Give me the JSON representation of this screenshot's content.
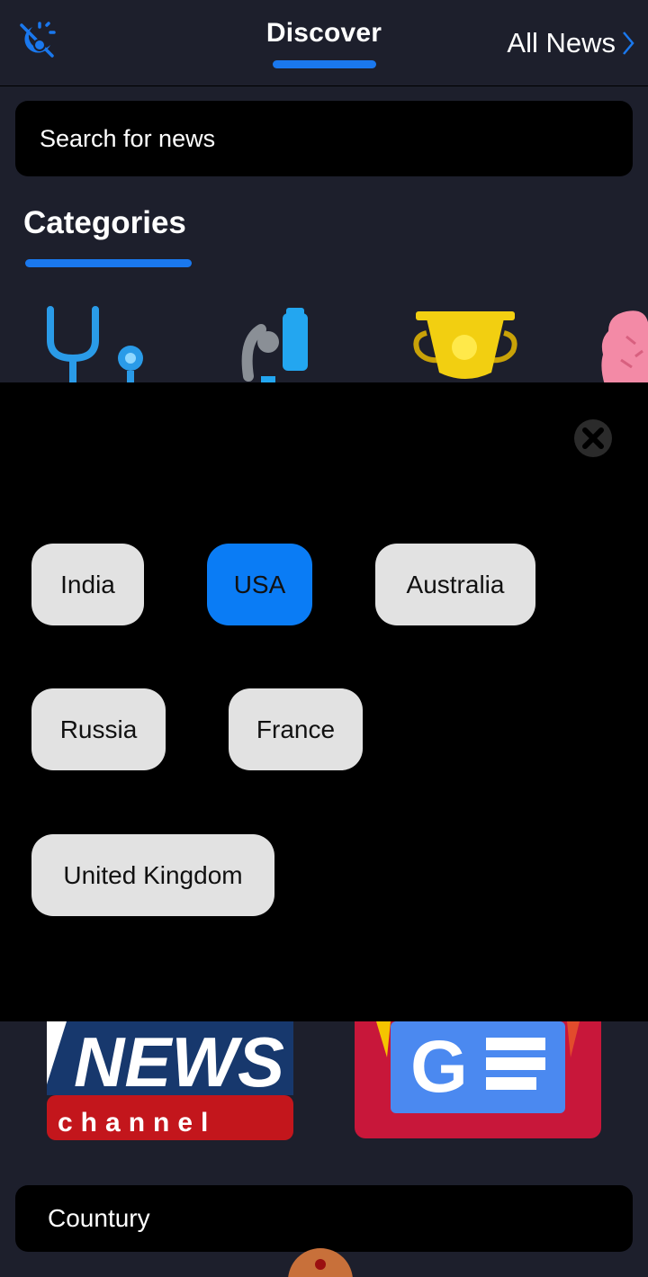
{
  "header": {
    "active_tab": "Discover",
    "all_news_label": "All News",
    "theme_icon": "dark-mode-icon",
    "chevron_icon": "chevron-right-icon"
  },
  "search": {
    "placeholder": "Search for news"
  },
  "categories": {
    "title": "Categories",
    "icons": [
      "stethoscope-icon",
      "microscope-icon",
      "trophy-icon",
      "brain-icon"
    ]
  },
  "country_picker": {
    "close_icon": "close-icon",
    "options": [
      {
        "label": "India",
        "selected": false
      },
      {
        "label": "USA",
        "selected": true
      },
      {
        "label": "Australia",
        "selected": false
      },
      {
        "label": "Russia",
        "selected": false
      },
      {
        "label": "France",
        "selected": false
      },
      {
        "label": "United Kingdom",
        "selected": false
      }
    ]
  },
  "sources": {
    "cards": [
      {
        "logo_text_top": "NEWS",
        "logo_text_bottom": "channel"
      },
      {
        "logo_text": "G",
        "icon": "google-news-icon"
      }
    ]
  },
  "country_section": {
    "label": "Countury"
  },
  "colors": {
    "background": "#1d1f2c",
    "accent": "#1a78ee",
    "selected_chip": "#0a7cf5",
    "chip": "#e2e2e2",
    "overlay": "#000000"
  }
}
